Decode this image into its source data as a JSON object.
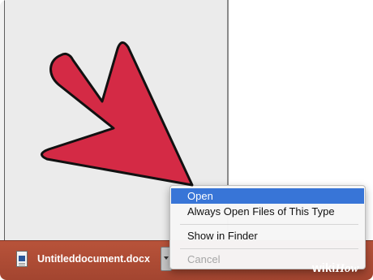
{
  "download": {
    "file_name": "Untitleddocument.docx",
    "file_icon": "word-document-icon",
    "dropdown_icon": "chevron-down-icon"
  },
  "context_menu": {
    "items": [
      {
        "label": "Open",
        "state": "selected"
      },
      {
        "label": "Always Open Files of This Type",
        "state": "normal"
      },
      {
        "label": "Show in Finder",
        "state": "normal"
      },
      {
        "label": "Cancel",
        "state": "disabled"
      }
    ]
  },
  "watermark": {
    "part1": "wiki",
    "part2": "How"
  },
  "annotation": {
    "arrow_color": "#d42a45",
    "arrow_icon": "pointer-arrow-icon"
  },
  "colors": {
    "download_bar": "#a8492f",
    "menu_highlight": "#3875d7"
  }
}
